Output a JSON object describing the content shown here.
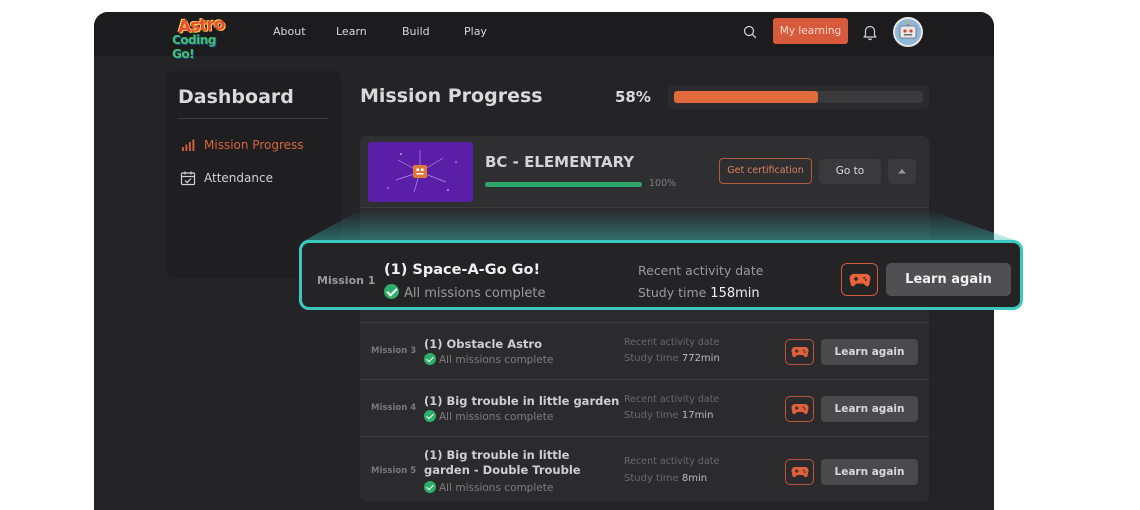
{
  "header": {
    "logo_line1": "Astro",
    "logo_line2": "Coding Go!",
    "nav": [
      "About",
      "Learn",
      "Build",
      "Play"
    ],
    "my_learning": "My learning"
  },
  "sidebar": {
    "title": "Dashboard",
    "items": [
      {
        "label": "Mission Progress",
        "icon": "bar-chart-icon",
        "active": true
      },
      {
        "label": "Attendance",
        "icon": "calendar-check-icon",
        "active": false
      }
    ]
  },
  "progress": {
    "title": "Mission Progress",
    "percent_label": "58%",
    "percent": 58
  },
  "course": {
    "name": "BC - ELEMENTARY",
    "percent_label": "100%",
    "percent": 100,
    "cert_label": "Get certification",
    "goto_label": "Go to"
  },
  "focused_mission": {
    "number": "Mission 1",
    "name": "(1) Space-A-Go Go!",
    "status": "All missions complete",
    "recent_label": "Recent activity date",
    "study_label": "Study time",
    "study_value": "158min",
    "button": "Learn again"
  },
  "missions": [
    {
      "number": "Mission 3",
      "name": "(1) Obstacle Astro",
      "status": "All missions complete",
      "recent_label": "Recent activity date",
      "study_label": "Study time",
      "study_value": "772min",
      "button": "Learn again"
    },
    {
      "number": "Mission 4",
      "name": "(1) Big trouble in little garden",
      "status": "All missions complete",
      "recent_label": "Recent activity date",
      "study_label": "Study time",
      "study_value": "17min",
      "button": "Learn again"
    },
    {
      "number": "Mission 5",
      "name": "(1) Big trouble in little garden - Double Trouble",
      "status": "All missions complete",
      "recent_label": "Recent activity date",
      "study_label": "Study time",
      "study_value": "8min",
      "button": "Learn again"
    }
  ],
  "colors": {
    "accent": "#e06a3c",
    "success": "#2fa66a",
    "highlight": "#3cc8c0",
    "background": "#242426"
  }
}
